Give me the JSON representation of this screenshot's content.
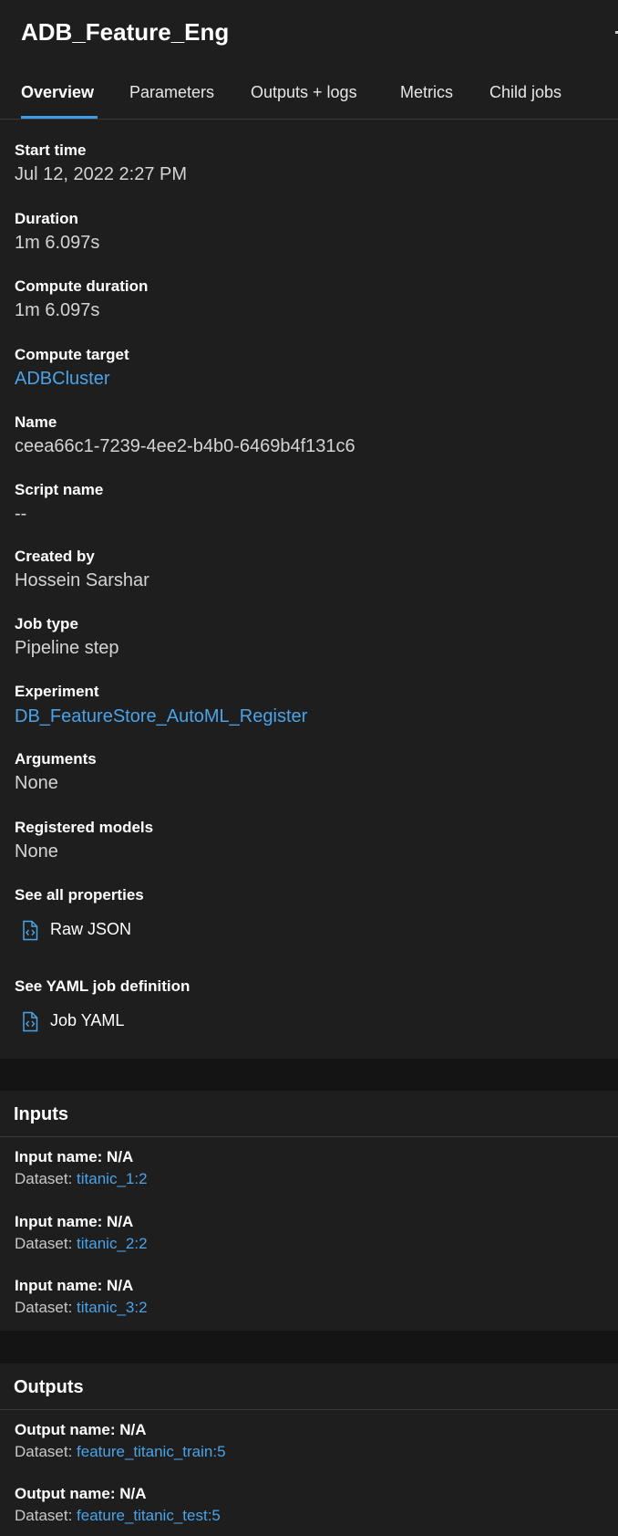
{
  "job": {
    "title": "ADB_Feature_Eng"
  },
  "tabs": [
    {
      "label": "Overview",
      "active": true
    },
    {
      "label": "Parameters",
      "active": false
    },
    {
      "label": "Outputs + logs",
      "active": false
    },
    {
      "label": "Metrics",
      "active": false
    },
    {
      "label": "Child jobs",
      "active": false
    }
  ],
  "overview": {
    "start_time": {
      "label": "Start time",
      "value": "Jul 12, 2022 2:27 PM"
    },
    "duration": {
      "label": "Duration",
      "value": "1m 6.097s"
    },
    "compute_duration": {
      "label": "Compute duration",
      "value": "1m 6.097s"
    },
    "compute_target": {
      "label": "Compute target",
      "value": "ADBCluster"
    },
    "name": {
      "label": "Name",
      "value": "ceea66c1-7239-4ee2-b4b0-6469b4f131c6"
    },
    "script_name": {
      "label": "Script name",
      "value": "--"
    },
    "created_by": {
      "label": "Created by",
      "value": "Hossein Sarshar"
    },
    "job_type": {
      "label": "Job type",
      "value": "Pipeline step"
    },
    "experiment": {
      "label": "Experiment",
      "value": "DB_FeatureStore_AutoML_Register"
    },
    "arguments": {
      "label": "Arguments",
      "value": "None"
    },
    "registered_models": {
      "label": "Registered models",
      "value": "None"
    },
    "see_all_properties": {
      "label": "See all properties",
      "link_label": "Raw JSON",
      "icon": "code-file-icon"
    },
    "see_yaml": {
      "label": "See YAML job definition",
      "link_label": "Job YAML",
      "icon": "code-file-icon"
    }
  },
  "inputs": {
    "title": "Inputs",
    "items": [
      {
        "name": "Input name: N/A",
        "dataset_prefix": "Dataset: ",
        "dataset": "titanic_1:2"
      },
      {
        "name": "Input name: N/A",
        "dataset_prefix": "Dataset: ",
        "dataset": "titanic_2:2"
      },
      {
        "name": "Input name: N/A",
        "dataset_prefix": "Dataset: ",
        "dataset": "titanic_3:2"
      }
    ]
  },
  "outputs": {
    "title": "Outputs",
    "items": [
      {
        "name": "Output name: N/A",
        "dataset_prefix": "Dataset: ",
        "dataset": "feature_titanic_train:5"
      },
      {
        "name": "Output name: N/A",
        "dataset_prefix": "Dataset: ",
        "dataset": "feature_titanic_test:5"
      }
    ]
  },
  "colors": {
    "accent": "#3b9dea",
    "link": "#4aa3e8",
    "panel_bg": "#1e1e1e",
    "page_bg": "#141414"
  }
}
